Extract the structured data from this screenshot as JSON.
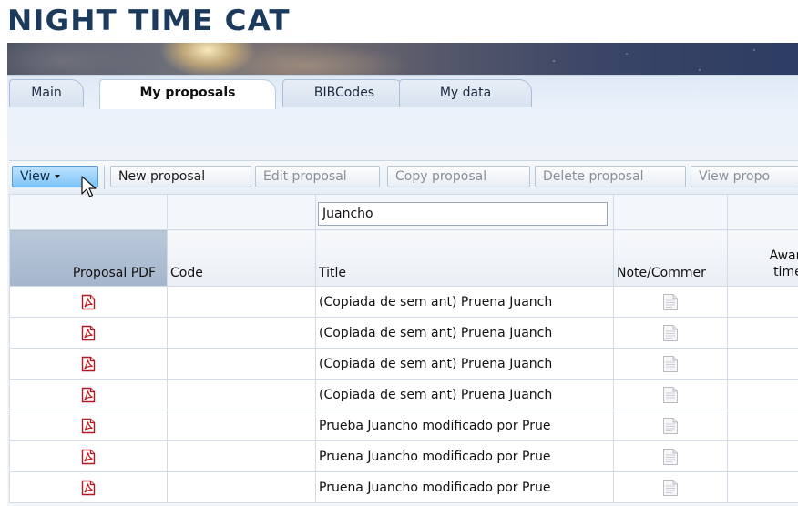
{
  "app": {
    "title": "NIGHT TIME CAT"
  },
  "tabs": [
    {
      "label": "Main",
      "active": false
    },
    {
      "label": "My proposals",
      "active": true
    },
    {
      "label": "BIBCodes",
      "active": false
    },
    {
      "label": "My data",
      "active": false
    }
  ],
  "toolbar": {
    "view_label": "View",
    "new_label": "New proposal",
    "edit_label": "Edit proposal",
    "copy_label": "Copy proposal",
    "delete_label": "Delete proposal",
    "view_proposal_label": "View propo"
  },
  "filter": {
    "title_value": "Juancho"
  },
  "table": {
    "columns": {
      "pdf": "Proposal PDF",
      "code": "Code",
      "title": "Title",
      "note": "Note/Commer",
      "award_line1": "Award",
      "award_line2": "times"
    },
    "rows": [
      {
        "code": "",
        "title": "(Copiada de sem ant) Pruena Juanch"
      },
      {
        "code": "",
        "title": "(Copiada de sem ant) Pruena Juanch"
      },
      {
        "code": "",
        "title": "(Copiada de sem ant) Pruena Juanch"
      },
      {
        "code": "",
        "title": "(Copiada de sem ant) Pruena Juanch"
      },
      {
        "code": "",
        "title": "Prueba Juancho modificado por Prue"
      },
      {
        "code": "",
        "title": "Pruena Juancho modificado por Prue"
      },
      {
        "code": "",
        "title": "Pruena Juancho modificado por Prue"
      }
    ]
  },
  "icons": {
    "pdf": "pdf-file-icon",
    "note": "note-document-icon",
    "cursor": "mouse-pointer-icon"
  },
  "colors": {
    "title": "#1b3a5c",
    "view_button": "#7cc4f7",
    "pdf_red": "#c8202a"
  }
}
